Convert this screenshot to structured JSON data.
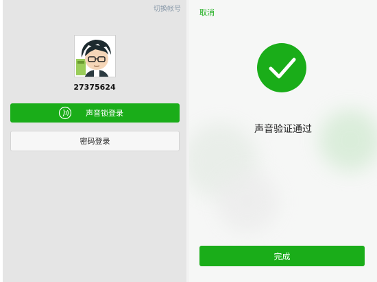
{
  "left_screen": {
    "switch_account_label": "切换帐号",
    "account_id": "27375624",
    "voice_login_label": "声音锁登录",
    "password_login_label": "密码登录"
  },
  "right_screen": {
    "cancel_label": "取消",
    "verify_message": "声音验证通过",
    "done_label": "完成"
  },
  "colors": {
    "accent_green": "#1aad19",
    "link_gray": "#8a9aaa",
    "left_background": "#e5e5e5"
  },
  "icons": {
    "voice": "voiceprint-icon",
    "success": "checkmark-icon",
    "avatar": "cartoon-avatar"
  }
}
